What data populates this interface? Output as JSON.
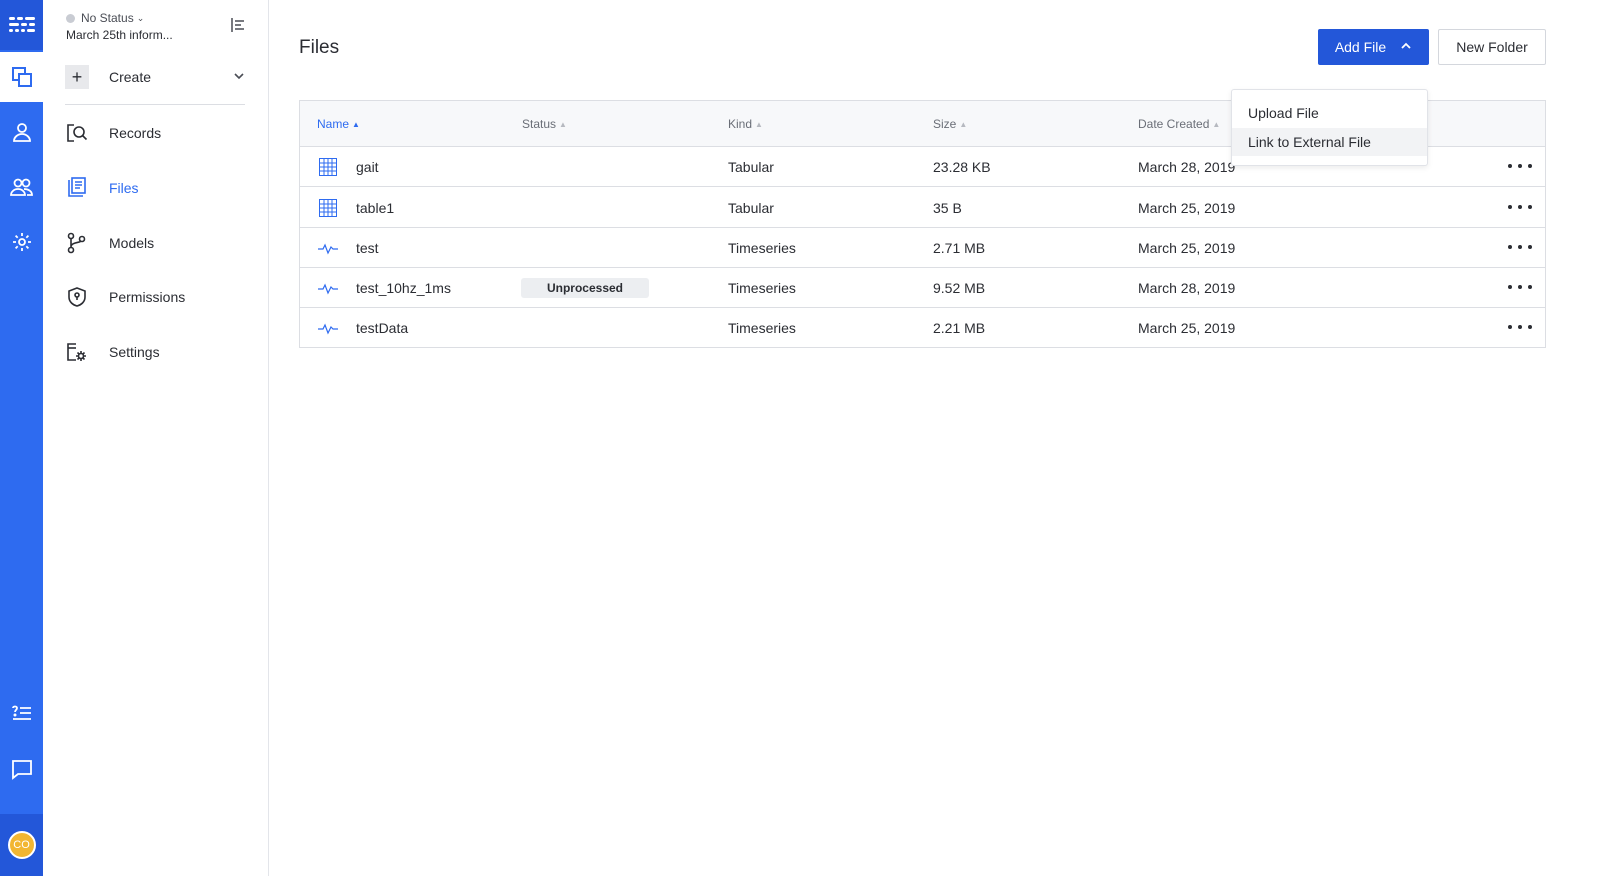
{
  "rail": {
    "logo_icon": "app-logo-icon",
    "items": [
      {
        "name": "datasets-icon",
        "active": true
      },
      {
        "name": "user-icon",
        "active": false
      },
      {
        "name": "team-icon",
        "active": false
      },
      {
        "name": "gear-icon",
        "active": false
      }
    ],
    "bottom_items": [
      "help-list-icon",
      "chat-icon"
    ],
    "avatar_initials": "CO"
  },
  "sidebar": {
    "status_label": "No Status",
    "dataset_name": "March 25th inform...",
    "create_label": "Create",
    "items": [
      {
        "label": "Records",
        "icon": "records-search-icon",
        "active": false
      },
      {
        "label": "Files",
        "icon": "files-icon",
        "active": true
      },
      {
        "label": "Models",
        "icon": "models-graph-icon",
        "active": false
      },
      {
        "label": "Permissions",
        "icon": "shield-icon",
        "active": false
      },
      {
        "label": "Settings",
        "icon": "settings-gear-icon",
        "active": false
      }
    ]
  },
  "main": {
    "title": "Files",
    "add_file_label": "Add File",
    "new_folder_label": "New Folder",
    "dropdown": {
      "items": [
        "Upload File",
        "Link to External File"
      ]
    },
    "table": {
      "columns": [
        "Name",
        "Status",
        "Kind",
        "Size",
        "Date Created"
      ],
      "rows": [
        {
          "name": "gait",
          "status": "",
          "kind": "Tabular",
          "size": "23.28 KB",
          "date": "March 28, 2019",
          "icon": "table-grid-icon"
        },
        {
          "name": "table1",
          "status": "",
          "kind": "Tabular",
          "size": "35 B",
          "date": "March 25, 2019",
          "icon": "table-grid-icon"
        },
        {
          "name": "test",
          "status": "",
          "kind": "Timeseries",
          "size": "2.71 MB",
          "date": "March 25, 2019",
          "icon": "timeseries-wave-icon"
        },
        {
          "name": "test_10hz_1ms",
          "status": "Unprocessed",
          "kind": "Timeseries",
          "size": "9.52 MB",
          "date": "March 28, 2019",
          "icon": "timeseries-wave-icon"
        },
        {
          "name": "testData",
          "status": "",
          "kind": "Timeseries",
          "size": "2.21 MB",
          "date": "March 25, 2019",
          "icon": "timeseries-wave-icon"
        }
      ]
    }
  },
  "colors": {
    "accent": "#2e6bf0",
    "accent_dark": "#2357d9",
    "avatar": "#f2b632"
  }
}
